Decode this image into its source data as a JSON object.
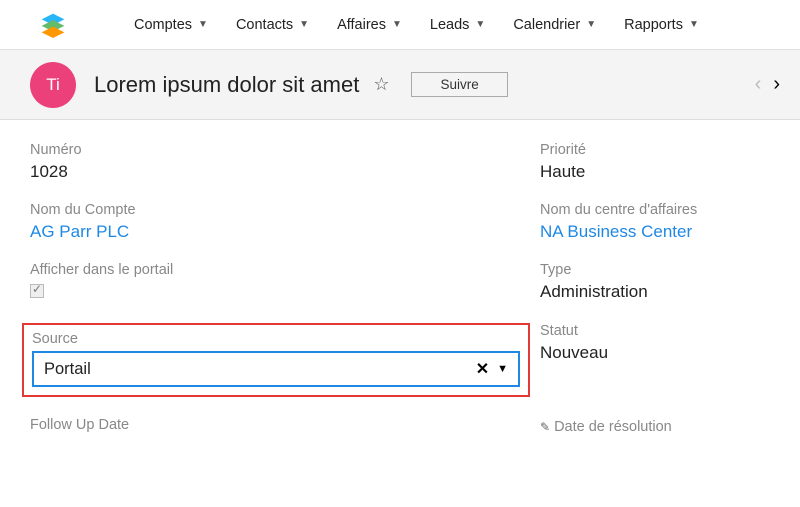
{
  "nav": {
    "items": [
      {
        "label": "Comptes"
      },
      {
        "label": "Contacts"
      },
      {
        "label": "Affaires"
      },
      {
        "label": "Leads"
      },
      {
        "label": "Calendrier"
      },
      {
        "label": "Rapports"
      }
    ]
  },
  "header": {
    "avatar_initials": "Ti",
    "title": "Lorem ipsum dolor sit amet",
    "follow_label": "Suivre"
  },
  "fields": {
    "numero": {
      "label": "Numéro",
      "value": "1028"
    },
    "priorite": {
      "label": "Priorité",
      "value": "Haute"
    },
    "nom_compte": {
      "label": "Nom du Compte",
      "value": "AG Parr PLC"
    },
    "nom_centre": {
      "label": "Nom du centre d'affaires",
      "value": "NA Business Center"
    },
    "afficher_portail": {
      "label": "Afficher dans le portail",
      "checked": true
    },
    "type": {
      "label": "Type",
      "value": "Administration"
    },
    "source": {
      "label": "Source",
      "value": "Portail"
    },
    "statut": {
      "label": "Statut",
      "value": "Nouveau"
    },
    "follow_up": {
      "label": "Follow Up Date"
    },
    "date_resolution": {
      "label": "Date de résolution"
    }
  }
}
